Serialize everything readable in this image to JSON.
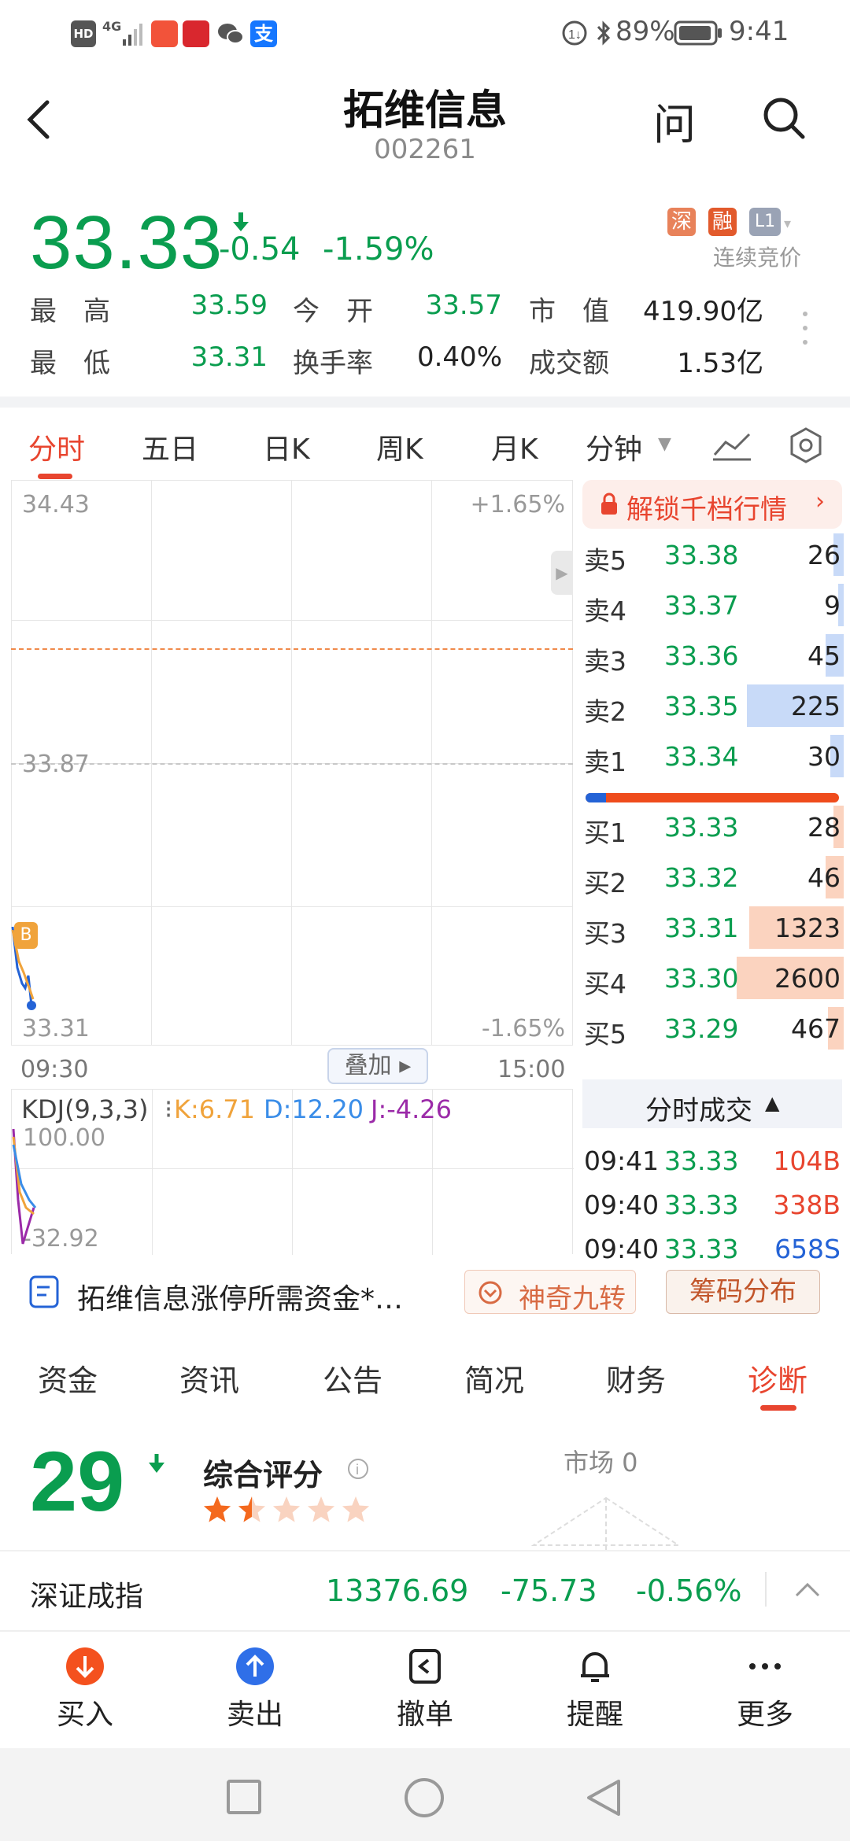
{
  "status_bar": {
    "signal_text": "HD",
    "network": "4G",
    "battery": "89%",
    "time": "9:41"
  },
  "header": {
    "back_icon": "chevron-left-icon",
    "title": "拓维信息",
    "code": "002261",
    "ask_label": "问",
    "search_icon": "search-icon"
  },
  "quote": {
    "price": "33.33",
    "change": "-0.54",
    "change_pct": "-1.59%",
    "tags": [
      "深",
      "融",
      "L1"
    ],
    "session": "连续竞价",
    "high_label": "最　高",
    "high": "33.59",
    "open_label": "今　开",
    "open": "33.57",
    "mktcap_label": "市　值",
    "mktcap": "419.90亿",
    "low_label": "最　低",
    "low": "33.31",
    "turnover_label": "换手率",
    "turnover": "0.40%",
    "amount_label": "成交额",
    "amount": "1.53亿"
  },
  "chart_tabs": {
    "items": [
      "分时",
      "五日",
      "日K",
      "周K",
      "月K",
      "分钟"
    ],
    "active": "分时"
  },
  "chart": {
    "y_top": "34.43",
    "y_mid": "33.87",
    "y_bottom": "33.31",
    "pct_top": "+1.65%",
    "pct_bottom": "-1.65%",
    "time_start": "09:30",
    "time_end": "15:00",
    "overlay_button": "叠加",
    "b_marker": "B",
    "kdj_title": "KDJ(9,3,3)",
    "kdj_k": "K:6.71",
    "kdj_d": "D:12.20",
    "kdj_j": "J:-4.26",
    "kdj_top": "100.00",
    "kdj_bottom": "-32.92",
    "colors": {
      "price_line": "#2463d6",
      "avg_line": "#f0a33b",
      "prev_close": "#f08a4b",
      "k": "#f0a33b",
      "d": "#3a8de8",
      "j": "#9b2aa8"
    }
  },
  "orderbook": {
    "unlock_label": "解锁千档行情",
    "rows": [
      {
        "label": "卖5",
        "price": "33.38",
        "vol": "26",
        "bar": 0.04,
        "side": "sell"
      },
      {
        "label": "卖4",
        "price": "33.37",
        "vol": "9",
        "bar": 0.02,
        "side": "sell"
      },
      {
        "label": "卖3",
        "price": "33.36",
        "vol": "45",
        "bar": 0.07,
        "side": "sell"
      },
      {
        "label": "卖2",
        "price": "33.35",
        "vol": "225",
        "bar": 0.37,
        "side": "sell"
      },
      {
        "label": "卖1",
        "price": "33.34",
        "vol": "30",
        "bar": 0.05,
        "side": "sell"
      },
      {
        "label": "买1",
        "price": "33.33",
        "vol": "28",
        "bar": 0.04,
        "side": "buy"
      },
      {
        "label": "买2",
        "price": "33.32",
        "vol": "46",
        "bar": 0.07,
        "side": "buy"
      },
      {
        "label": "买3",
        "price": "33.31",
        "vol": "1323",
        "bar": 0.36,
        "side": "buy"
      },
      {
        "label": "买4",
        "price": "33.30",
        "vol": "2600",
        "bar": 0.41,
        "side": "buy"
      },
      {
        "label": "买5",
        "price": "33.29",
        "vol": "467",
        "bar": 0.06,
        "side": "buy"
      }
    ],
    "buy_sell_ratio": 0.08,
    "trades_label": "分时成交",
    "trades": [
      {
        "time": "09:41",
        "price": "33.33",
        "vol": "104B"
      },
      {
        "time": "09:40",
        "price": "33.33",
        "vol": "338B"
      },
      {
        "time": "09:40",
        "price": "33.33",
        "vol": "658S"
      }
    ]
  },
  "news": {
    "headline": "拓维信息涨停所需资金*…",
    "nine_turn": "神奇九转",
    "chip": "筹码分布"
  },
  "info_tabs": {
    "items": [
      "资金",
      "资讯",
      "公告",
      "简况",
      "财务",
      "诊断"
    ],
    "active": "诊断"
  },
  "diagnosis": {
    "score": "29",
    "score_label": "综合评分",
    "rating": 1.5,
    "market_label": "市场 0"
  },
  "index_bar": {
    "name": "深证成指",
    "value": "13376.69",
    "change": "-75.73",
    "change_pct": "-0.56%"
  },
  "action_bar": {
    "buy": "买入",
    "sell": "卖出",
    "cancel": "撤单",
    "remind": "提醒",
    "more": "更多"
  }
}
